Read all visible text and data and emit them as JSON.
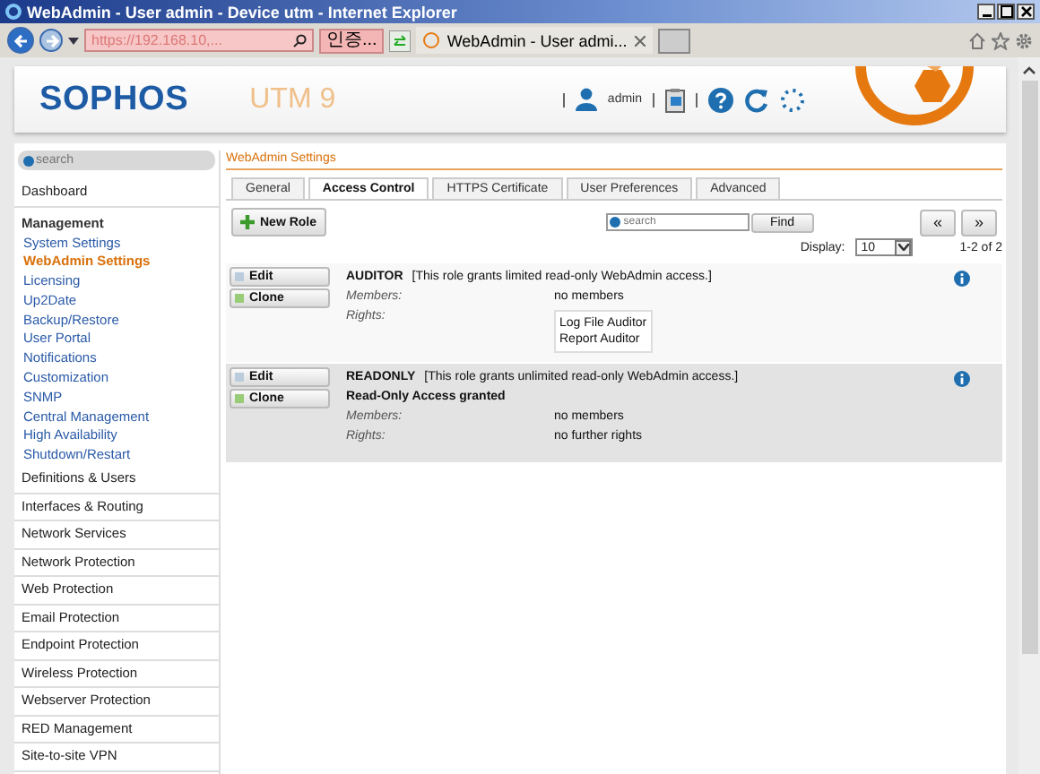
{
  "window": {
    "title": "WebAdmin - User admin - Device utm - Internet Explorer"
  },
  "browser": {
    "address": "https://192.168.10,...",
    "certificate": "인증...",
    "tab": "WebAdmin - User admi..."
  },
  "header": {
    "logo": "SOPHOS",
    "product": "UTM 9",
    "user": "admin"
  },
  "sidebar": {
    "search": {
      "placeholder": "search"
    },
    "items": [
      {
        "kind": "top",
        "label": "Dashboard",
        "selected": false
      },
      {
        "kind": "header",
        "label": "Management",
        "selected": false
      },
      {
        "kind": "sub",
        "label": "System Settings",
        "selected": false
      },
      {
        "kind": "sub",
        "label": "WebAdmin Settings",
        "selected": true
      },
      {
        "kind": "sub",
        "label": "Licensing",
        "selected": false
      },
      {
        "kind": "sub",
        "label": "Up2Date",
        "selected": false
      },
      {
        "kind": "sub",
        "label": "Backup/Restore",
        "selected": false
      },
      {
        "kind": "sub",
        "label": "User Portal",
        "selected": false
      },
      {
        "kind": "sub",
        "label": "Notifications",
        "selected": false
      },
      {
        "kind": "sub",
        "label": "Customization",
        "selected": false
      },
      {
        "kind": "sub",
        "label": "SNMP",
        "selected": false
      },
      {
        "kind": "sub",
        "label": "Central Management",
        "selected": false
      },
      {
        "kind": "sub",
        "label": "High Availability",
        "selected": false
      },
      {
        "kind": "sub",
        "label": "Shutdown/Restart",
        "selected": false
      },
      {
        "kind": "top",
        "label": "Definitions & Users",
        "selected": false
      },
      {
        "kind": "top",
        "label": "Interfaces & Routing",
        "selected": false
      },
      {
        "kind": "top",
        "label": "Network Services",
        "selected": false
      },
      {
        "kind": "top",
        "label": "Network Protection",
        "selected": false
      },
      {
        "kind": "top",
        "label": "Web Protection",
        "selected": false
      },
      {
        "kind": "top",
        "label": "Email Protection",
        "selected": false
      },
      {
        "kind": "top",
        "label": "Endpoint Protection",
        "selected": false
      },
      {
        "kind": "top",
        "label": "Wireless Protection",
        "selected": false
      },
      {
        "kind": "top",
        "label": "Webserver Protection",
        "selected": false
      },
      {
        "kind": "top",
        "label": "RED Management",
        "selected": false
      },
      {
        "kind": "top",
        "label": "Site-to-site VPN",
        "selected": false
      }
    ]
  },
  "breadcrumb": "WebAdmin Settings",
  "tabs": [
    {
      "label": "General",
      "selected": false
    },
    {
      "label": "Access Control",
      "selected": true
    },
    {
      "label": "HTTPS Certificate",
      "selected": false
    },
    {
      "label": "User Preferences",
      "selected": false
    },
    {
      "label": "Advanced",
      "selected": false
    }
  ],
  "toolbar": {
    "new_role": "New Role",
    "search": {
      "placeholder": "search"
    },
    "find": "Find",
    "prev": "«",
    "next": "»",
    "display_label": "Display:",
    "display_value": "10",
    "range": "1-2 of 2"
  },
  "roles": [
    {
      "name": "AUDITOR",
      "description": "[This role grants limited read-only WebAdmin access.]",
      "selected": false,
      "edit": "Edit",
      "clone": "Clone",
      "members_label": "Members:",
      "members": "no members",
      "rights_label": "Rights:",
      "rights": [
        "Log File Auditor",
        "Report Auditor"
      ]
    },
    {
      "name": "READONLY",
      "description": "[This role grants unlimited read-only WebAdmin access.]",
      "selected": true,
      "edit": "Edit",
      "clone": "Clone",
      "note": "Read-Only Access granted",
      "members_label": "Members:",
      "members": "no members",
      "rights_label": "Rights:",
      "rights_text": "no further rights"
    }
  ]
}
